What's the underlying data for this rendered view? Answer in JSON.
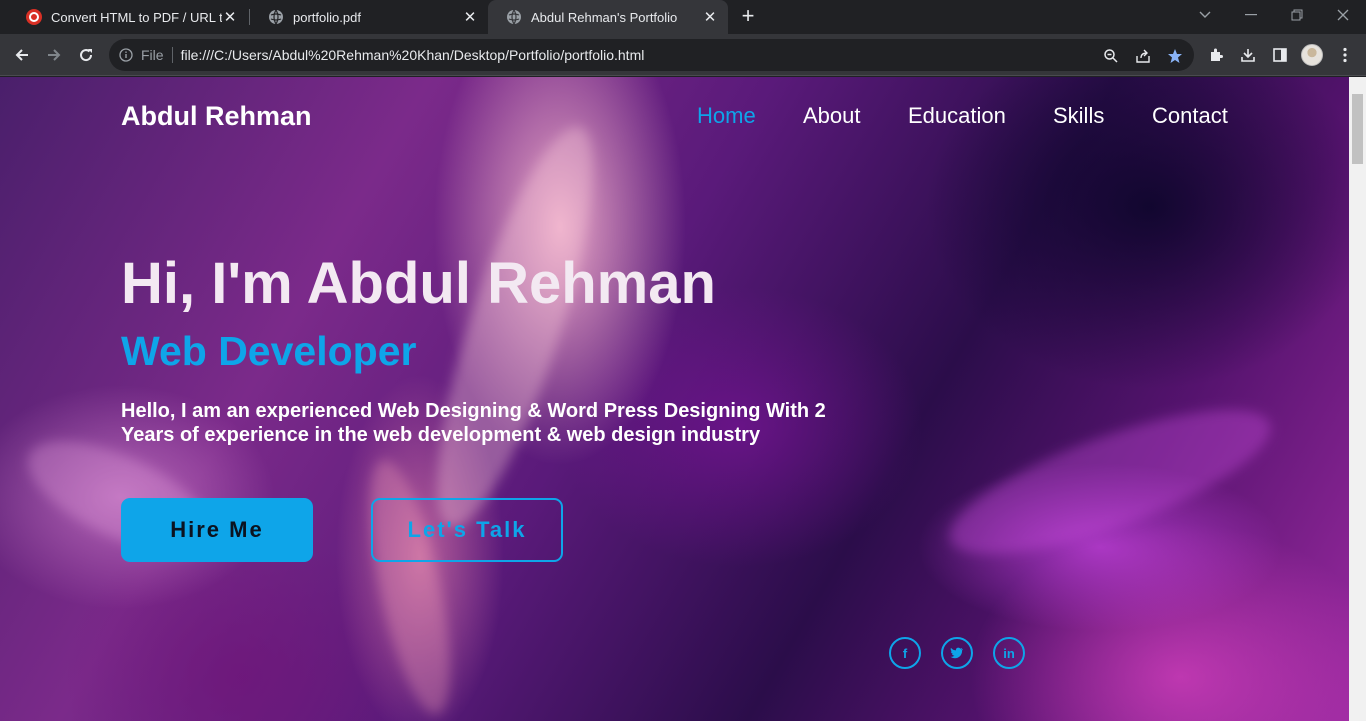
{
  "tabs": [
    {
      "title": "Convert HTML to PDF / URL to PDF",
      "favicon": "pdf-convert-icon"
    },
    {
      "title": "portfolio.pdf",
      "favicon": "globe-icon"
    },
    {
      "title": "Abdul Rehman's Portfolio",
      "favicon": "globe-icon"
    }
  ],
  "address_bar": {
    "scheme_label": "File",
    "url": "file:///C:/Users/Abdul%20Rehman%20Khan/Desktop/Portfolio/portfolio.html"
  },
  "site": {
    "logo": "Abdul Rehman",
    "nav": [
      "Home",
      "About",
      "Education",
      "Skills",
      "Contact"
    ],
    "active_nav": "Home",
    "hero_title": "Hi, I'm Abdul Rehman",
    "hero_subtitle": "Web Developer",
    "hero_description": "Hello, I am an experienced Web Designing & Word Press Designing With 2 Years of experience in the web development & web design industry",
    "buttons": {
      "hire": "Hire Me",
      "talk": "Let's Talk"
    },
    "social": [
      {
        "name": "facebook-icon",
        "glyph": "f"
      },
      {
        "name": "twitter-icon",
        "glyph": "t"
      },
      {
        "name": "linkedin-icon",
        "glyph": "in"
      }
    ]
  },
  "colors": {
    "accent": "#0ea5e9",
    "chrome_dark": "#202124",
    "chrome_toolbar": "#35363a"
  }
}
